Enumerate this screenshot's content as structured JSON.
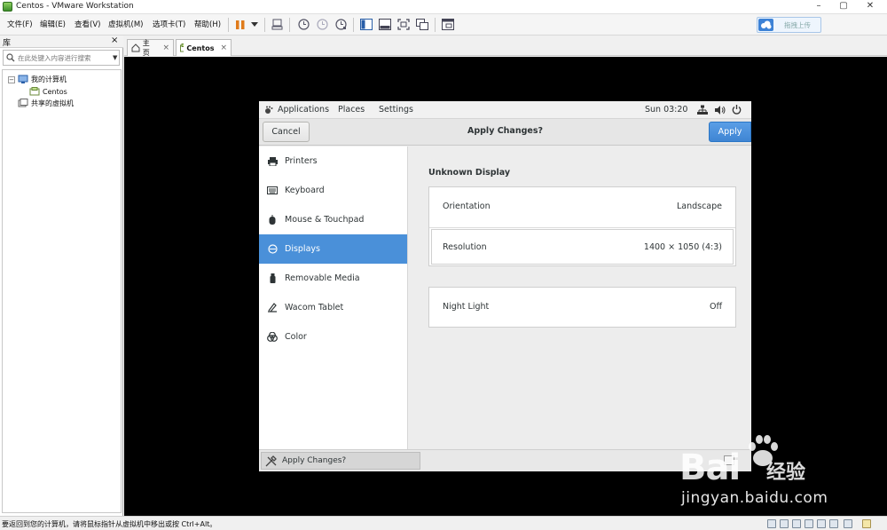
{
  "window": {
    "title": "Centos - VMware Workstation",
    "controls": [
      "–",
      "▢",
      "✕"
    ]
  },
  "menu": {
    "items": [
      "文件(F)",
      "编辑(E)",
      "查看(V)",
      "虚拟机(M)",
      "选项卡(T)",
      "帮助(H)"
    ],
    "upload_label": "拖拽上传"
  },
  "library": {
    "title": "库",
    "close": "×",
    "search_placeholder": "在此处键入内容进行搜索",
    "tree": {
      "my_computer": "我的计算机",
      "vm": "Centos",
      "shared": "共享的虚拟机"
    }
  },
  "tabs": [
    {
      "label": "主页",
      "close": "×"
    },
    {
      "label": "Centos",
      "close": "×"
    }
  ],
  "gnome": {
    "topbar": {
      "applications": "Applications",
      "places": "Places",
      "settings": "Settings",
      "clock": "Sun 03:20"
    },
    "header": {
      "cancel": "Cancel",
      "title": "Apply Changes?",
      "apply": "Apply"
    },
    "sidebar": [
      {
        "label": "Printers",
        "icon": "printer-icon"
      },
      {
        "label": "Keyboard",
        "icon": "keyboard-icon"
      },
      {
        "label": "Mouse & Touchpad",
        "icon": "mouse-icon"
      },
      {
        "label": "Displays",
        "icon": "display-icon",
        "selected": true
      },
      {
        "label": "Removable Media",
        "icon": "usb-icon"
      },
      {
        "label": "Wacom Tablet",
        "icon": "tablet-icon"
      },
      {
        "label": "Color",
        "icon": "color-icon"
      }
    ],
    "content": {
      "heading": "Unknown Display",
      "orientation_label": "Orientation",
      "orientation_value": "Landscape",
      "resolution_label": "Resolution",
      "resolution_value": "1400 × 1050 (4:3)",
      "night_light_label": "Night Light",
      "night_light_value": "Off"
    },
    "taskbar_item": "Apply Changes?"
  },
  "statusbar": {
    "text": "要返回到您的计算机，请将鼠标指针从虚拟机中移出或按 Ctrl+Alt。"
  },
  "watermark": {
    "brand": "Bai",
    "brand_tail": "经验",
    "url": "jingyan.baidu.com"
  },
  "colors": {
    "selection": "#4a90d9",
    "apply_button": "#3f85d3",
    "vm_background": "#000000"
  }
}
